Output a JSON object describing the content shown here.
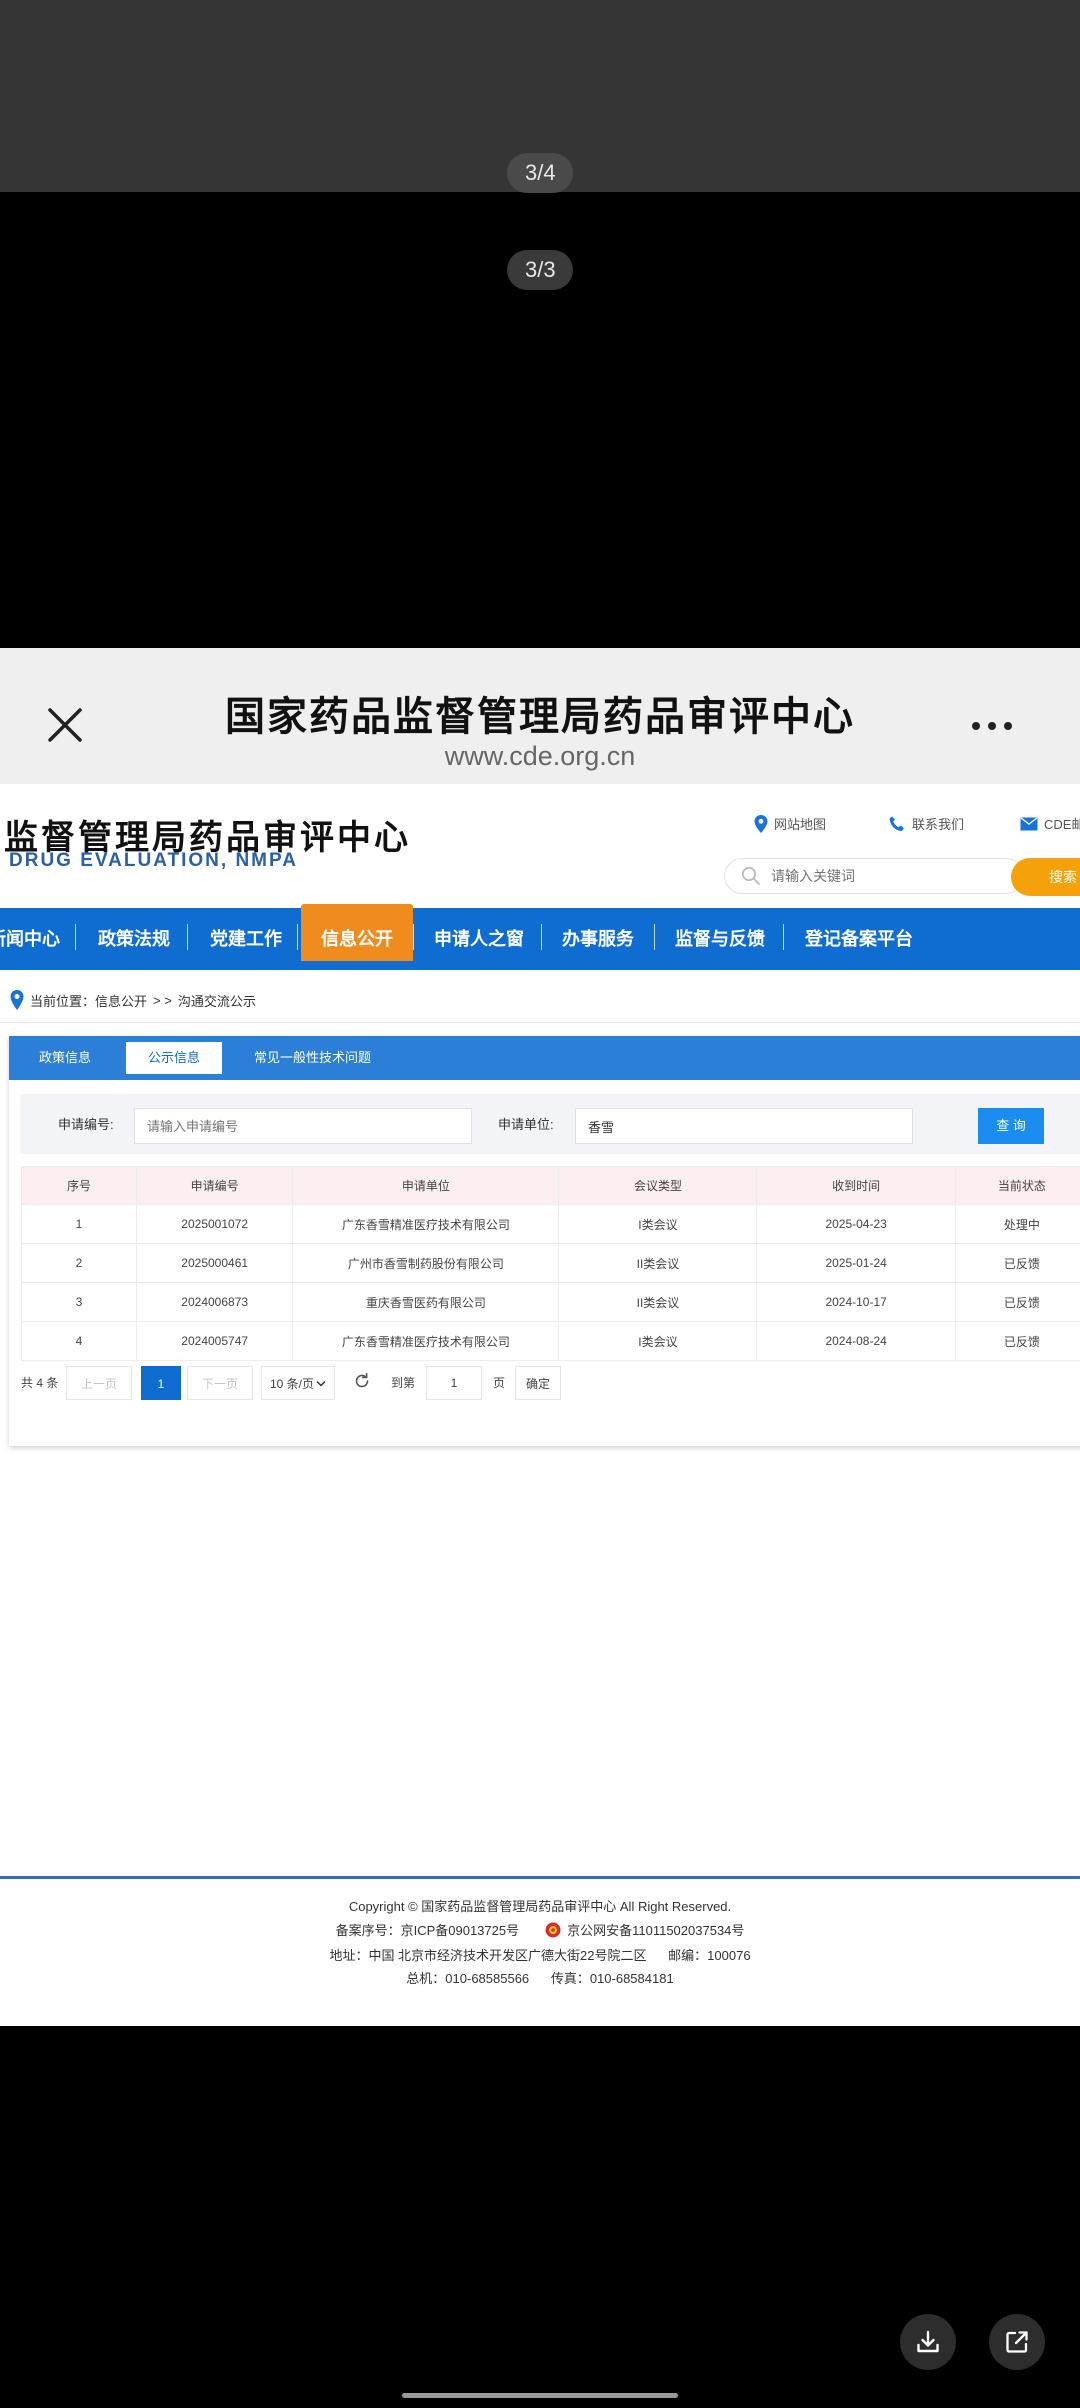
{
  "viewer": {
    "counter_top": "3/4",
    "counter_second": "3/3"
  },
  "browser": {
    "title": "国家药品监督管理局药品审评中心",
    "url": "www.cde.org.cn"
  },
  "site": {
    "title": "监督管理局药品审评中心",
    "subtitle": "DRUG EVALUATION, NMPA",
    "links": {
      "sitemap": "网站地图",
      "contact": "联系我们",
      "cde": "CDE邮"
    },
    "search_placeholder": "请输入关键词",
    "search_button": "搜索"
  },
  "nav": {
    "items": [
      "新闻中心",
      "政策法规",
      "党建工作",
      "信息公开",
      "申请人之窗",
      "办事服务",
      "监督与反馈",
      "登记备案平台"
    ],
    "active_index": 3
  },
  "breadcrumb": {
    "prefix": "当前位置：",
    "level1": "信息公开",
    "separator": "> >",
    "level2": "沟通交流公示"
  },
  "tabs": [
    "政策信息",
    "公示信息",
    "常见一般性技术问题"
  ],
  "active_tab": 1,
  "filters": {
    "application_no_label": "申请编号:",
    "application_no_placeholder": "请输入申请编号",
    "application_no_value": "",
    "applicant_label": "申请单位:",
    "applicant_value": "香雪",
    "query_button": "查 询"
  },
  "table": {
    "headers": [
      "序号",
      "申请编号",
      "申请单位",
      "会议类型",
      "收到时间",
      "当前状态"
    ],
    "rows": [
      [
        "1",
        "2025001072",
        "广东香雪精准医疗技术有限公司",
        "I类会议",
        "2025-04-23",
        "处理中"
      ],
      [
        "2",
        "2025000461",
        "广州市香雪制药股份有限公司",
        "II类会议",
        "2025-01-24",
        "已反馈"
      ],
      [
        "3",
        "2024006873",
        "重庆香雪医药有限公司",
        "II类会议",
        "2024-10-17",
        "已反馈"
      ],
      [
        "4",
        "2024005747",
        "广东香雪精准医疗技术有限公司",
        "I类会议",
        "2024-08-24",
        "已反馈"
      ]
    ]
  },
  "pagination": {
    "total": "共 4 条",
    "prev": "上一页",
    "current": "1",
    "next": "下一页",
    "page_size": "10 条/页",
    "goto_label": "到第",
    "goto_value": "1",
    "page_unit": "页",
    "confirm": "确定"
  },
  "footer": {
    "copyright": "Copyright © 国家药品监督管理局药品审评中心   All Right Reserved.",
    "icp": "备案序号：京ICP备09013725号",
    "police": "京公网安备11011502037534号",
    "address": "地址：中国 北京市经济技术开发区广德大街22号院二区      邮编：100076",
    "phone": "总机：010-68585566      传真：010-68584181"
  },
  "colors": {
    "nav_blue": "#0f6cd1",
    "nav_active": "#f08b1e",
    "search_orange": "#f5a20a",
    "table_header": "#fdeef1"
  }
}
